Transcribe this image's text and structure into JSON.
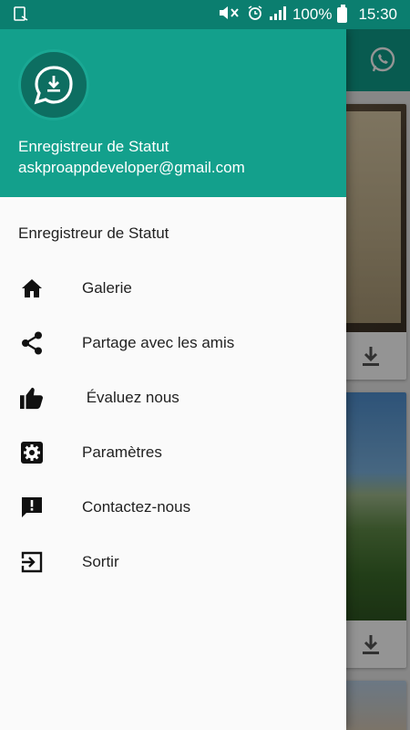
{
  "status_bar": {
    "battery_text": "100%",
    "time": "15:30",
    "icons": [
      "screenshot-icon",
      "mute-icon",
      "alarm-icon",
      "signal-icon",
      "battery-icon"
    ]
  },
  "drawer": {
    "header": {
      "app_name": "Enregistreur de Statut",
      "email": "askproappdeveloper@gmail.com",
      "logo_icon": "download-bubble-icon"
    },
    "section_title": "Enregistreur de Statut",
    "items": [
      {
        "label": "Galerie",
        "icon": "home-icon"
      },
      {
        "label": "Partage avec les amis",
        "icon": "share-icon"
      },
      {
        "label": " Évaluez nous",
        "icon": "thumbs-up-icon"
      },
      {
        "label": "Paramètres",
        "icon": "settings-icon"
      },
      {
        "label": "Contactez-nous",
        "icon": "feedback-icon"
      },
      {
        "label": "Sortir",
        "icon": "exit-icon"
      }
    ]
  },
  "background": {
    "toolbar_icon": "whatsapp-icon",
    "card_action_icon": "download-icon"
  },
  "colors": {
    "status_bar": "#0b7e6f",
    "header": "#13a08c",
    "accent": "#0f9e8a"
  }
}
